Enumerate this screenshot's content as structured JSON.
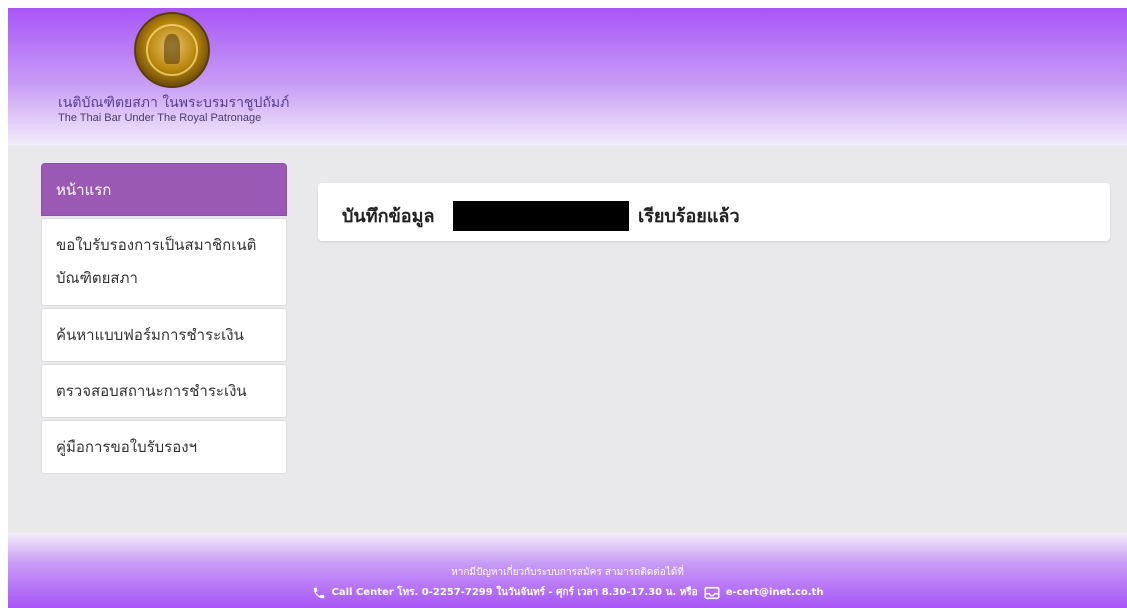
{
  "header": {
    "org_name_th": "เนติบัณฑิตยสภา ในพระบรมราชูปถัมภ์",
    "org_name_en": "The Thai Bar Under The Royal Patronage"
  },
  "sidebar": {
    "items": [
      {
        "label": "หน้าแรก",
        "active": true
      },
      {
        "label": "ขอใบรับรองการเป็นสมาชิกเนติบัณฑิตยสภา"
      },
      {
        "label": "ค้นหาแบบฟอร์มการชำระเงิน"
      },
      {
        "label": "ตรวจสอบสถานะการชำระเงิน"
      },
      {
        "label": "คู่มือการขอใบรับรองฯ"
      }
    ]
  },
  "main": {
    "message_prefix": "บันทึกข้อมูล",
    "message_suffix": "เรียบร้อยแล้ว"
  },
  "footer": {
    "line1": "หากมีปัญหาเกี่ยวกับระบบการสมัคร สามารถติดต่อได้ที่",
    "line2_phone": "Call Center โทร. 0-2257-7299 ในวันจันทร์ - ศุกร์ เวลา 8.30-17.30 น. หรือ",
    "line2_email": "e-cert@inet.co.th"
  },
  "colors": {
    "header_purple": "#a855f7",
    "active_item": "#9b59b6",
    "background": "#e9e9ec"
  }
}
